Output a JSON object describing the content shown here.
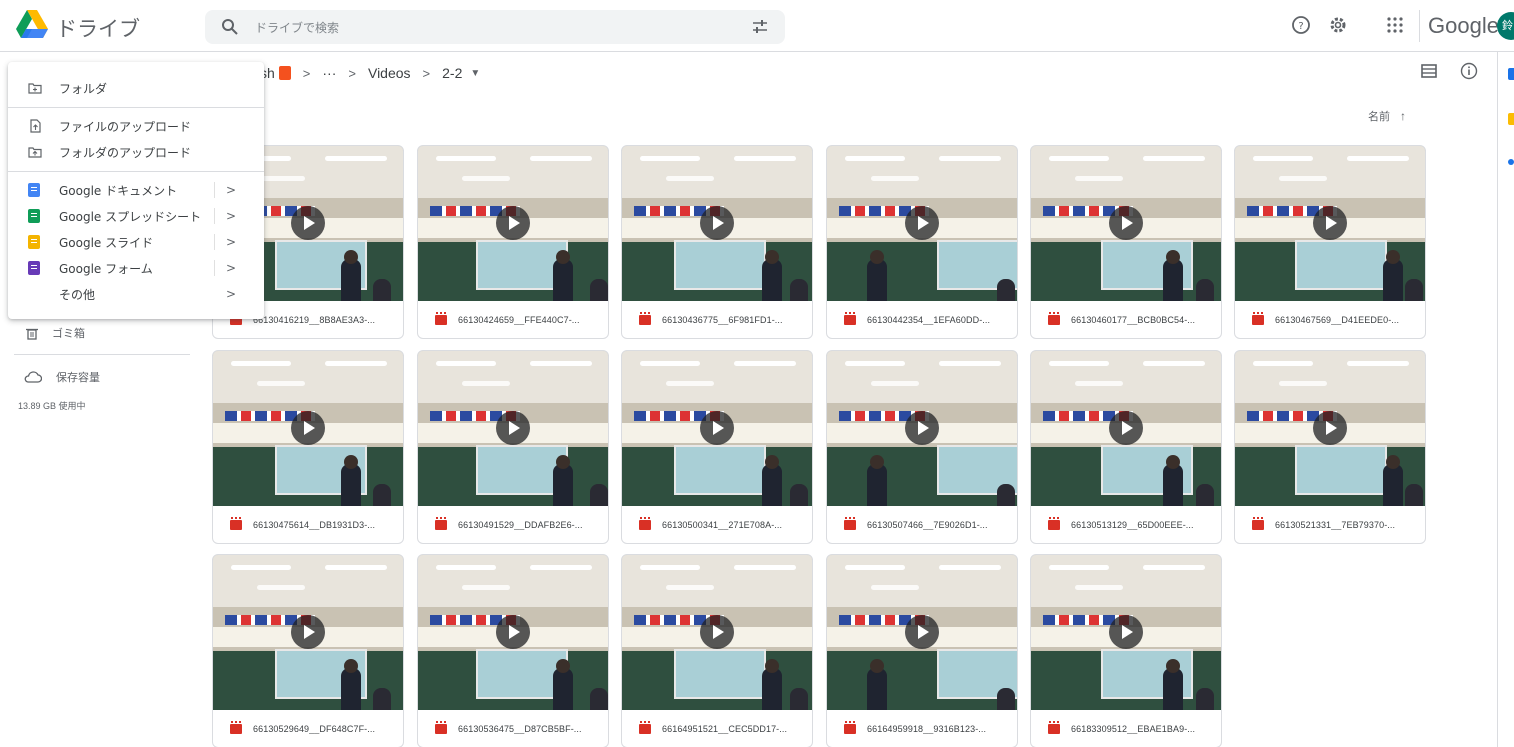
{
  "app": {
    "title": "ドライブ"
  },
  "search": {
    "placeholder": "ドライブで検索"
  },
  "header": {
    "wordmark": "Google",
    "account_initial": "鈴"
  },
  "breadcrumb": {
    "root_partial": "sh",
    "ellipsis": "···",
    "folder": "Videos",
    "current": "2-2",
    "separator": ">"
  },
  "sort": {
    "label": "名前",
    "arrow": "↑"
  },
  "sidebar": {
    "trash": "ゴミ箱",
    "storage": "保存容量",
    "storage_used": "13.89 GB 使用中"
  },
  "new_menu": {
    "folder": "フォルダ",
    "file_upload": "ファイルのアップロード",
    "folder_upload": "フォルダのアップロード",
    "docs": "Google ドキュメント",
    "sheets": "Google スプレッドシート",
    "slides": "Google スライド",
    "forms": "Google フォーム",
    "more": "その他",
    "chevron": ">"
  },
  "colors": {
    "docs": "#4285f4",
    "sheets": "#0f9d58",
    "slides": "#f4b400",
    "forms": "#673ab7",
    "video_icon": "#d93025",
    "shared_badge": "#f4511e"
  },
  "files": [
    {
      "name": "66130416219__8B8AE3A3-..."
    },
    {
      "name": "66130424659__FFE440C7-..."
    },
    {
      "name": "66130436775__6F981FD1-..."
    },
    {
      "name": "66130442354__1EFA60DD-..."
    },
    {
      "name": "66130460177__BCB0BC54-..."
    },
    {
      "name": "66130467569__D41EEDE0-..."
    },
    {
      "name": "66130475614__DB1931D3-..."
    },
    {
      "name": "66130491529__DDAFB2E6-..."
    },
    {
      "name": "66130500341__271E708A-..."
    },
    {
      "name": "66130507466__7E9026D1-..."
    },
    {
      "name": "66130513129__65D00EEE-..."
    },
    {
      "name": "66130521331__7EB79370-..."
    },
    {
      "name": "66130529649__DF648C7F-..."
    },
    {
      "name": "66130536475__D87CB5BF-..."
    },
    {
      "name": "66164951521__CEC5DD17-..."
    },
    {
      "name": "66164959918__9316B123-..."
    },
    {
      "name": "66183309512__EBAE1BA9-..."
    }
  ]
}
